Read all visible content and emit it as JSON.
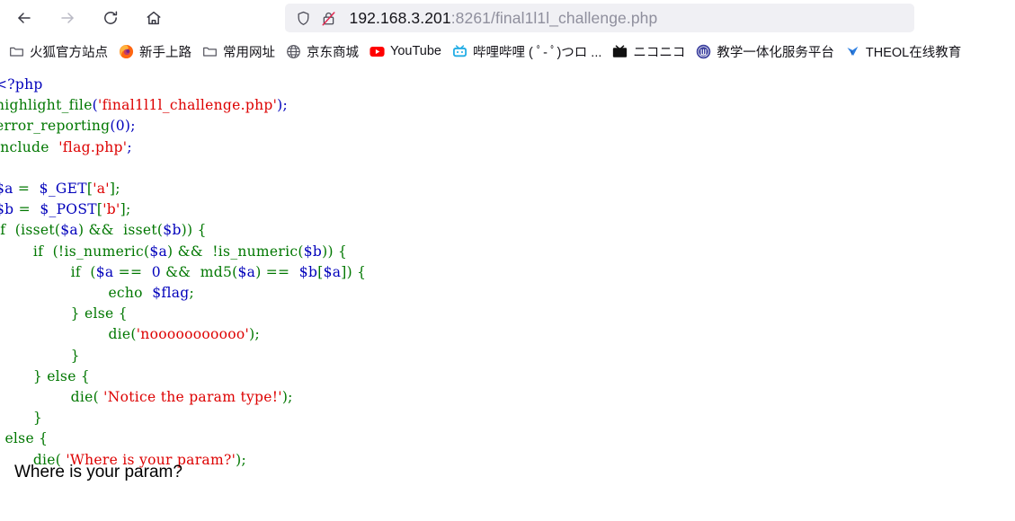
{
  "browser": {
    "nav": {
      "back": {
        "label": "Back",
        "icon": "arrow-left-icon",
        "enabled": true
      },
      "forward": {
        "label": "Forward",
        "icon": "arrow-right-icon",
        "enabled": false
      },
      "reload": {
        "label": "Reload",
        "icon": "reload-icon",
        "enabled": true
      },
      "home": {
        "label": "Home",
        "icon": "home-icon",
        "enabled": true
      }
    },
    "urlbar": {
      "shield_icon": "shield-icon",
      "lock_icon": "lock-insecure-icon",
      "host": "192.168.3.201",
      "rest": ":8261/final1l1l_challenge.php",
      "full_url": "192.168.3.201:8261/final1l1l_challenge.php"
    },
    "bookmarks": [
      {
        "label": "火狐官方站点",
        "icon": "folder-icon"
      },
      {
        "label": "新手上路",
        "icon": "firefox-icon"
      },
      {
        "label": "常用网址",
        "icon": "folder-icon"
      },
      {
        "label": "京东商城",
        "icon": "globe-icon"
      },
      {
        "label": "YouTube",
        "icon": "youtube-icon"
      },
      {
        "label": "哔哩哔哩 ( ﾟ- ﾟ)つロ ...",
        "icon": "bilibili-icon"
      },
      {
        "label": "ニコニコ",
        "icon": "niconico-icon"
      },
      {
        "label": "教学一体化服务平台",
        "icon": "university-icon"
      },
      {
        "label": "THEOL在线教育",
        "icon": "theol-icon"
      }
    ]
  },
  "page": {
    "source_lines": [
      [
        {
          "t": "<?php",
          "c": "c-default"
        }
      ],
      [
        {
          "t": "highlight_file",
          "c": "c-kw"
        },
        {
          "t": "(",
          "c": "c-default"
        },
        {
          "t": "'final1l1l_challenge.php'",
          "c": "c-str"
        },
        {
          "t": ");",
          "c": "c-default"
        }
      ],
      [
        {
          "t": "error_reporting",
          "c": "c-kw"
        },
        {
          "t": "(",
          "c": "c-default"
        },
        {
          "t": "0",
          "c": "c-num"
        },
        {
          "t": ");",
          "c": "c-default"
        }
      ],
      [
        {
          "t": "include ",
          "c": "c-kw"
        },
        {
          "t": " 'flag.php'",
          "c": "c-str"
        },
        {
          "t": ";",
          "c": "c-default"
        }
      ],
      [
        {
          "t": "",
          "c": "c-default"
        }
      ],
      [
        {
          "t": "$a",
          "c": "c-default"
        },
        {
          "t": " = ",
          "c": "c-kw"
        },
        {
          "t": " $_GET",
          "c": "c-default"
        },
        {
          "t": "[",
          "c": "c-kw"
        },
        {
          "t": "'a'",
          "c": "c-str"
        },
        {
          "t": "];",
          "c": "c-kw"
        }
      ],
      [
        {
          "t": "$b",
          "c": "c-default"
        },
        {
          "t": " = ",
          "c": "c-kw"
        },
        {
          "t": " $_POST",
          "c": "c-default"
        },
        {
          "t": "[",
          "c": "c-kw"
        },
        {
          "t": "'b'",
          "c": "c-str"
        },
        {
          "t": "];",
          "c": "c-kw"
        }
      ],
      [
        {
          "t": "if ",
          "c": "c-kw"
        },
        {
          "t": " (isset(",
          "c": "c-kw"
        },
        {
          "t": "$a",
          "c": "c-default"
        },
        {
          "t": ") && ",
          "c": "c-kw"
        },
        {
          "t": " isset(",
          "c": "c-kw"
        },
        {
          "t": "$b",
          "c": "c-default"
        },
        {
          "t": ")) {",
          "c": "c-kw"
        }
      ],
      [
        {
          "t": "        if ",
          "c": "c-kw"
        },
        {
          "t": " (!is_numeric(",
          "c": "c-kw"
        },
        {
          "t": "$a",
          "c": "c-default"
        },
        {
          "t": ") && ",
          "c": "c-kw"
        },
        {
          "t": " !is_numeric(",
          "c": "c-kw"
        },
        {
          "t": "$b",
          "c": "c-default"
        },
        {
          "t": ")) {",
          "c": "c-kw"
        }
      ],
      [
        {
          "t": "                if ",
          "c": "c-kw"
        },
        {
          "t": " (",
          "c": "c-kw"
        },
        {
          "t": "$a",
          "c": "c-default"
        },
        {
          "t": " == ",
          "c": "c-kw"
        },
        {
          "t": " 0",
          "c": "c-num"
        },
        {
          "t": " && ",
          "c": "c-kw"
        },
        {
          "t": " md5(",
          "c": "c-kw"
        },
        {
          "t": "$a",
          "c": "c-default"
        },
        {
          "t": ") == ",
          "c": "c-kw"
        },
        {
          "t": " $b",
          "c": "c-default"
        },
        {
          "t": "[",
          "c": "c-kw"
        },
        {
          "t": "$a",
          "c": "c-default"
        },
        {
          "t": "]) {",
          "c": "c-kw"
        }
      ],
      [
        {
          "t": "                        echo ",
          "c": "c-kw"
        },
        {
          "t": " $flag",
          "c": "c-default"
        },
        {
          "t": ";",
          "c": "c-kw"
        }
      ],
      [
        {
          "t": "                } else {",
          "c": "c-kw"
        }
      ],
      [
        {
          "t": "                        die(",
          "c": "c-kw"
        },
        {
          "t": "'nooooooooooo'",
          "c": "c-str"
        },
        {
          "t": ");",
          "c": "c-kw"
        }
      ],
      [
        {
          "t": "                }",
          "c": "c-kw"
        }
      ],
      [
        {
          "t": "        } else {",
          "c": "c-kw"
        }
      ],
      [
        {
          "t": "                die( ",
          "c": "c-kw"
        },
        {
          "t": "'Notice the param type!'",
          "c": "c-str"
        },
        {
          "t": ");",
          "c": "c-kw"
        }
      ],
      [
        {
          "t": "        }",
          "c": "c-kw"
        }
      ],
      [
        {
          "t": "  else {",
          "c": "c-kw"
        }
      ],
      [
        {
          "t": "        die( ",
          "c": "c-kw"
        },
        {
          "t": "'Where is your param?'",
          "c": "c-str"
        },
        {
          "t": ");",
          "c": "c-kw"
        }
      ]
    ],
    "output_text": "Where is your param?"
  },
  "colors": {
    "php_keyword_green": "#007700",
    "php_string_red": "#dd0000",
    "php_default_blue": "#0000bb",
    "urlbar_bg": "#f0f0f4",
    "text": "#15141a",
    "dim_text": "#8f8f9d",
    "insecure_red": "#e22850"
  }
}
